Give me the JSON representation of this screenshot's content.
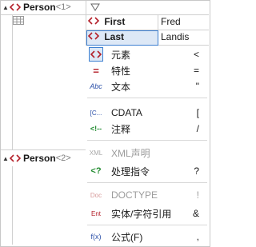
{
  "tree": {
    "person1": {
      "label": "Person",
      "suffix": "<1>"
    },
    "person2": {
      "label": "Person",
      "suffix": "<2>"
    }
  },
  "table": {
    "rows": [
      {
        "name": "First",
        "value": "Fred"
      },
      {
        "name": "Last",
        "value": "Landis"
      }
    ]
  },
  "menu": {
    "items": [
      {
        "label": "元素",
        "key": "<",
        "icon": "element-tag-icon"
      },
      {
        "label": "特性",
        "key": "=",
        "icon": "attribute-icon",
        "glyph": "="
      },
      {
        "label": "文本",
        "key": "\"",
        "icon": "text-icon",
        "glyph": "Abc"
      },
      {
        "label": "CDATA",
        "key": "[",
        "icon": "cdata-icon",
        "glyph": "[C..."
      },
      {
        "label": "注释",
        "key": "/",
        "icon": "comment-icon",
        "glyph": "<!--"
      },
      {
        "label": "XML声明",
        "key": "",
        "icon": "xml-declaration-icon",
        "glyph": "XML"
      },
      {
        "label": "处理指令",
        "key": "?",
        "icon": "processing-instruction-icon",
        "glyph": "<?"
      },
      {
        "label": "DOCTYPE",
        "key": "!",
        "icon": "doctype-icon",
        "glyph": "Doc"
      },
      {
        "label": "实体/字符引用",
        "key": "&",
        "icon": "entity-reference-icon",
        "glyph": "Ent"
      },
      {
        "label": "公式(F)",
        "key": ",",
        "icon": "formula-icon",
        "glyph": "f(x)"
      }
    ]
  },
  "colors": {
    "tag": "#b4202a",
    "selection": "#dde8f6",
    "selection_border": "#3c7fd1",
    "disabled": "#9c9c9c"
  }
}
